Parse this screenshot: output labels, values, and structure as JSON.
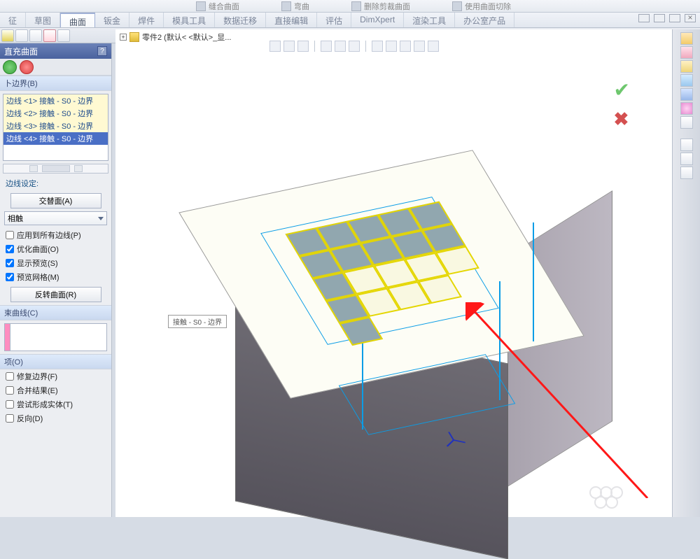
{
  "top_tools": {
    "t1": "缝合曲面",
    "t2": "弯曲",
    "t3": "删除剪裁曲面",
    "t4": "使用曲面切除"
  },
  "ribbon": {
    "tabs": [
      "征",
      "草图",
      "曲面",
      "钣金",
      "焊件",
      "模具工具",
      "数据迁移",
      "直接编辑",
      "评估",
      "DimXpert",
      "渲染工具",
      "办公室产品"
    ],
    "active_index": 2
  },
  "doc": {
    "label": "零件2 (默认< <默认>_显..."
  },
  "panel": {
    "title": "直充曲面",
    "section_boundary": "卜边界(B)",
    "edges": [
      "边线 <1> 接触 - S0 - 边界",
      "边线 <2> 接触 - S0 - 边界",
      "边线 <3> 接触 - S0 - 边界",
      "边线 <4> 接触 - S0 - 边界"
    ],
    "edge_setting": "边线设定:",
    "btn_alt_face": "交替面(A)",
    "dropdown_value": "相触",
    "chk_apply_all": "应用到所有边线(P)",
    "chk_optimize": "优化曲面(O)",
    "chk_preview": "显示预览(S)",
    "chk_preview_mesh": "预览网格(M)",
    "btn_reverse": "反转曲面(R)",
    "section_curve": "束曲线(C)",
    "section_options": "项(O)",
    "chk_fix_boundary": "修复边界(F)",
    "chk_merge": "合并结果(E)",
    "chk_try_solid": "尝试形成实体(T)",
    "chk_reverse_dir": "反向(D)"
  },
  "tip": "接触 - S0 - 边界"
}
